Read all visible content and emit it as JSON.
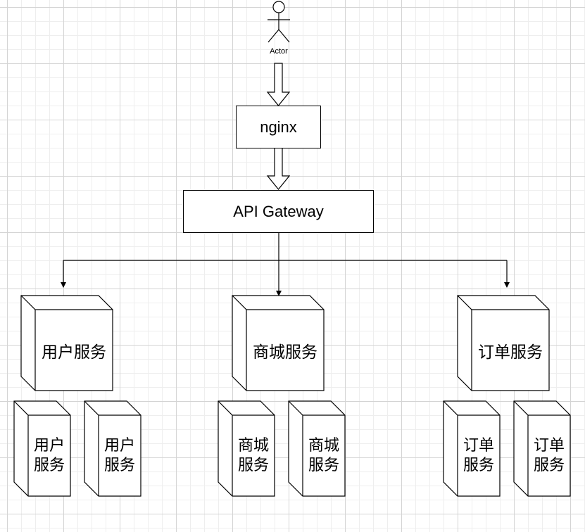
{
  "actor": {
    "label": "Actor"
  },
  "nginx": {
    "label": "nginx"
  },
  "gateway": {
    "label": "API Gateway"
  },
  "services": {
    "user": {
      "label": "用户服务",
      "replica_line1": "用户",
      "replica_line2": "服务"
    },
    "mall": {
      "label": "商城服务",
      "replica_line1": "商城",
      "replica_line2": "服务"
    },
    "order": {
      "label": "订单服务",
      "replica_line1": "订单",
      "replica_line2": "服务"
    }
  },
  "colors": {
    "stroke": "#000000",
    "fill": "#ffffff",
    "grid": "#d4d4d4"
  }
}
